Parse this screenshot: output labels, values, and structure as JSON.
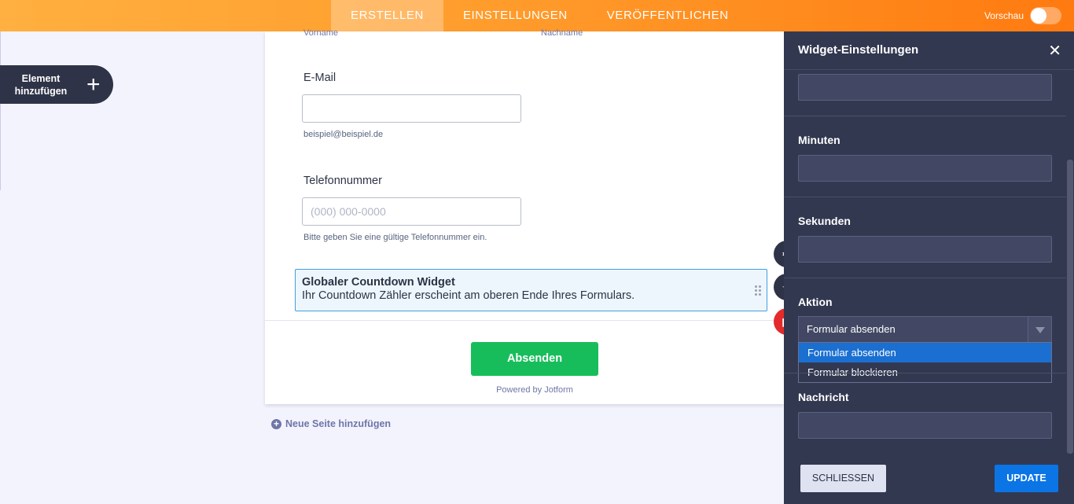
{
  "topbar": {
    "tabs": [
      {
        "label": "ERSTELLEN",
        "active": true
      },
      {
        "label": "EINSTELLUNGEN",
        "active": false
      },
      {
        "label": "VERÖFFENTLICHEN",
        "active": false
      }
    ],
    "preview_label": "Vorschau",
    "preview_on": false
  },
  "sidebar": {
    "add_element_label_line1": "Element",
    "add_element_label_line2": "hinzufügen",
    "add_icon": "plus-icon"
  },
  "form": {
    "name_sublabels": {
      "first": "Vorname",
      "last": "Nachname"
    },
    "email": {
      "label": "E-Mail",
      "value": "",
      "hint": "beispiel@beispiel.de"
    },
    "phone": {
      "label": "Telefonnummer",
      "placeholder": "(000) 000-0000",
      "hint": "Bitte geben Sie eine gültige Telefonnummer ein."
    },
    "widget": {
      "title": "Globaler Countdown Widget",
      "description": "Ihr Countdown Zähler erscheint am oberen Ende Ihres Formulars."
    },
    "submit_label": "Absenden",
    "powered_by": "Powered by Jotform",
    "new_page_label": "Neue Seite hinzufügen"
  },
  "panel": {
    "title": "Widget-Einstellungen",
    "fields": {
      "minutes_label": "Minuten",
      "seconds_label": "Sekunden",
      "action_label": "Aktion",
      "message_label": "Nachricht"
    },
    "action": {
      "selected": "Formular absenden",
      "options": [
        "Formular absenden",
        "Formular blockieren"
      ]
    },
    "close_button": "SCHLIESSEN",
    "update_button": "UPDATE"
  },
  "colors": {
    "accent_orange": "#ff9a2a",
    "submit_green": "#18bd5b",
    "panel_bg": "#333851",
    "update_blue": "#0b75e6"
  }
}
